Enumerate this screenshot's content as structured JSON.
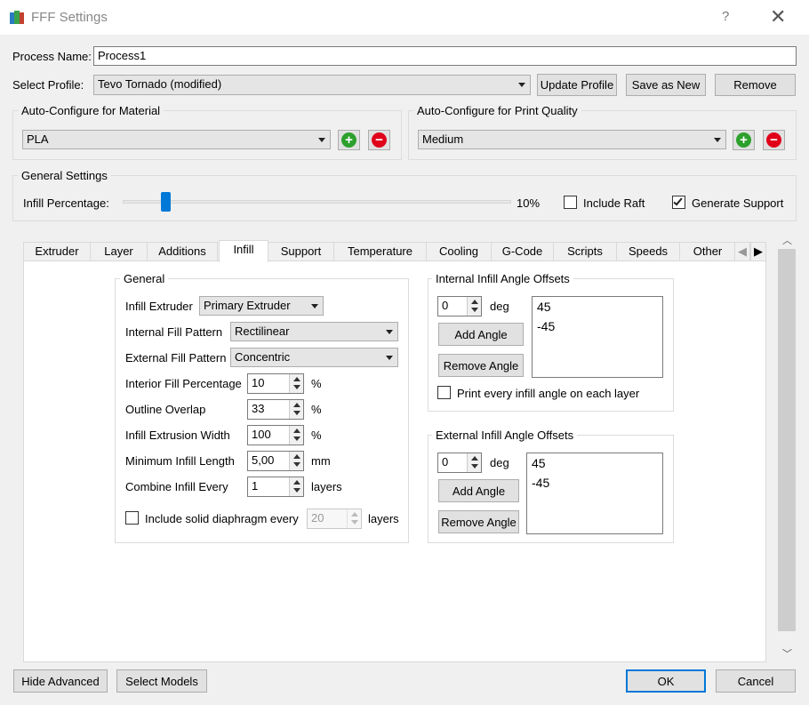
{
  "window": {
    "title": "FFF Settings",
    "help": "?",
    "close": "✕"
  },
  "process": {
    "label": "Process Name:",
    "value": "Process1"
  },
  "profile": {
    "label": "Select Profile:",
    "value": "Tevo Tornado (modified)",
    "update": "Update Profile",
    "save_new": "Save as New",
    "remove": "Remove"
  },
  "material": {
    "title": "Auto-Configure for Material",
    "value": "PLA"
  },
  "quality": {
    "title": "Auto-Configure for Print Quality",
    "value": "Medium"
  },
  "general": {
    "title": "General Settings",
    "infill_label": "Infill Percentage:",
    "infill_value": "10%",
    "infill_fraction": 0.1,
    "raft": "Include Raft",
    "raft_checked": false,
    "support": "Generate Support",
    "support_checked": true
  },
  "tabs": [
    "Extruder",
    "Layer",
    "Additions",
    "Infill",
    "Support",
    "Temperature",
    "Cooling",
    "G-Code",
    "Scripts",
    "Speeds",
    "Other"
  ],
  "active_tab": "Infill",
  "infill": {
    "group_title": "General",
    "extruder_label": "Infill Extruder",
    "extruder_value": "Primary Extruder",
    "internal_label": "Internal Fill Pattern",
    "internal_value": "Rectilinear",
    "external_label": "External Fill Pattern",
    "external_value": "Concentric",
    "interior_label": "Interior Fill Percentage",
    "interior_value": "10",
    "interior_unit": "%",
    "overlap_label": "Outline Overlap",
    "overlap_value": "33",
    "overlap_unit": "%",
    "width_label": "Infill Extrusion Width",
    "width_value": "100",
    "width_unit": "%",
    "minlen_label": "Minimum Infill Length",
    "minlen_value": "5,00",
    "minlen_unit": "mm",
    "combine_label": "Combine Infill Every",
    "combine_value": "1",
    "combine_unit": "layers",
    "diaphragm_label": "Include solid diaphragm every",
    "diaphragm_value": "20",
    "diaphragm_unit": "layers"
  },
  "internal_angles": {
    "title": "Internal Infill Angle Offsets",
    "value": "0",
    "unit": "deg",
    "add": "Add Angle",
    "remove": "Remove Angle",
    "list": [
      "45",
      "-45"
    ],
    "print_every": "Print every infill angle on each layer"
  },
  "external_angles": {
    "title": "External Infill Angle Offsets",
    "value": "0",
    "unit": "deg",
    "add": "Add Angle",
    "remove": "Remove Angle",
    "list": [
      "45",
      "-45"
    ]
  },
  "footer": {
    "hide_advanced": "Hide Advanced",
    "select_models": "Select Models",
    "ok": "OK",
    "cancel": "Cancel"
  },
  "colors": {
    "accent": "#0078d7",
    "add_green": "#2ca02c",
    "remove_red": "#e0001a",
    "slider_handle": "#0078d7"
  }
}
